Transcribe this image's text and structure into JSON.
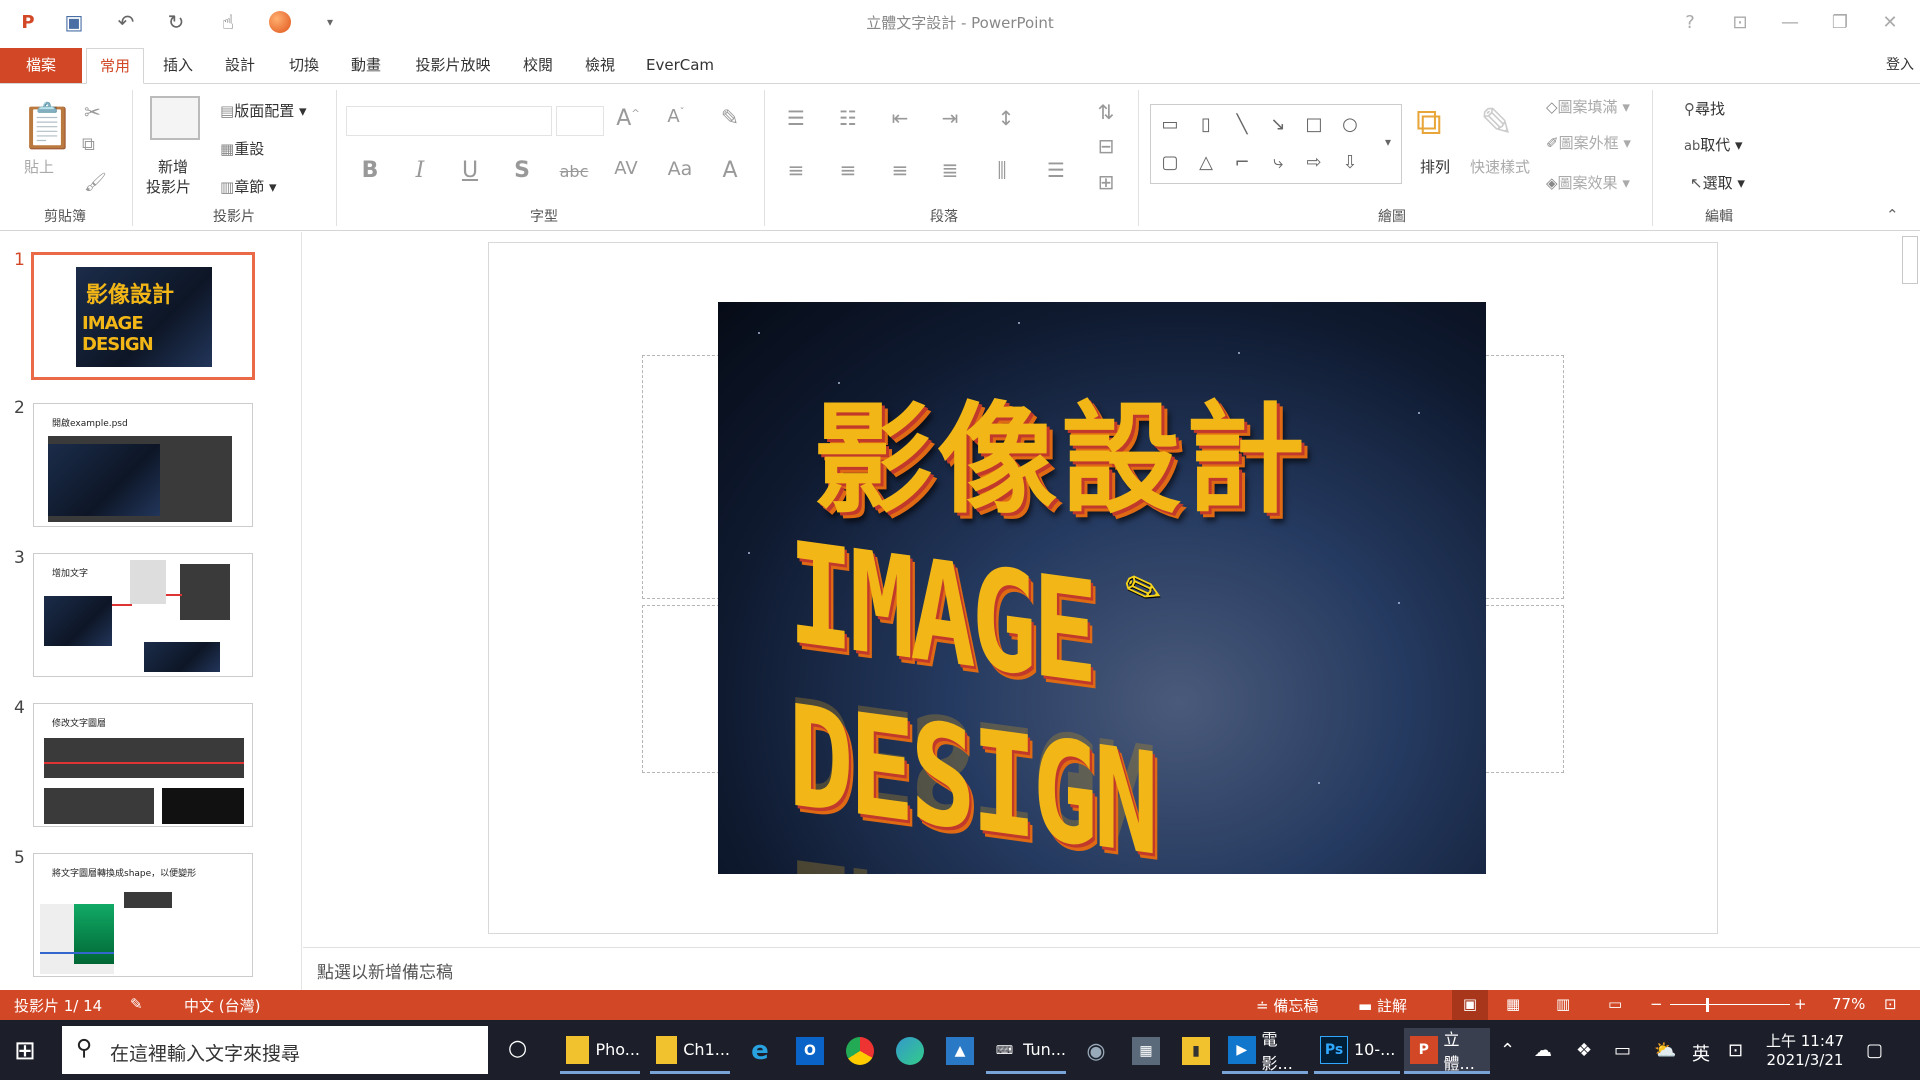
{
  "window": {
    "title": "立體文字設計 - PowerPoint"
  },
  "tabs": [
    {
      "label": "檔案"
    },
    {
      "label": "常用"
    },
    {
      "label": "插入"
    },
    {
      "label": "設計"
    },
    {
      "label": "切換"
    },
    {
      "label": "動畫"
    },
    {
      "label": "投影片放映"
    },
    {
      "label": "校閱"
    },
    {
      "label": "檢視"
    },
    {
      "label": "EverCam"
    }
  ],
  "signin": "登入",
  "ribbon": {
    "clipboard": {
      "paste": "貼上",
      "group": "剪貼簿"
    },
    "slides": {
      "new_slide_1": "新增",
      "new_slide_2": "投影片",
      "layout": "版面配置",
      "reset": "重設",
      "section": "章節",
      "group": "投影片"
    },
    "font": {
      "group": "字型"
    },
    "paragraph": {
      "group": "段落"
    },
    "drawing": {
      "arrange": "排列",
      "quick_styles": "快速樣式",
      "fill": "圖案填滿",
      "outline": "圖案外框",
      "effects": "圖案效果",
      "group": "繪圖"
    },
    "editing": {
      "find": "尋找",
      "replace": "取代",
      "select": "選取",
      "group": "編輯"
    }
  },
  "slides": [
    {
      "num": "1",
      "caption": ""
    },
    {
      "num": "2",
      "caption": "開啟example.psd"
    },
    {
      "num": "3",
      "caption": "增加文字"
    },
    {
      "num": "4",
      "caption": "修改文字圖層"
    },
    {
      "num": "5",
      "caption": "將文字圖層轉換成shape，以便變形"
    }
  ],
  "slide_image": {
    "text_cn": "影像設計",
    "text_en": "IMAGE DESIGN"
  },
  "notes_placeholder": "點選以新增備忘稿",
  "status": {
    "slide_indicator": "投影片 1/ 14",
    "language": "中文 (台灣)",
    "notes": "備忘稿",
    "comments": "註解",
    "zoom": "77%"
  },
  "taskbar": {
    "search_placeholder": "在這裡輸入文字來搜尋",
    "apps": [
      {
        "label": "Pho..."
      },
      {
        "label": "Ch1..."
      },
      {
        "label": "Tun..."
      },
      {
        "label": "電影..."
      },
      {
        "label": "10-..."
      },
      {
        "label": "立體..."
      }
    ],
    "ime": "英",
    "time": "上午 11:47",
    "date": "2021/3/21"
  },
  "colors": {
    "accent": "#d24726",
    "taskbar": "#1c1f2a",
    "text_gold": "#f2b617"
  }
}
